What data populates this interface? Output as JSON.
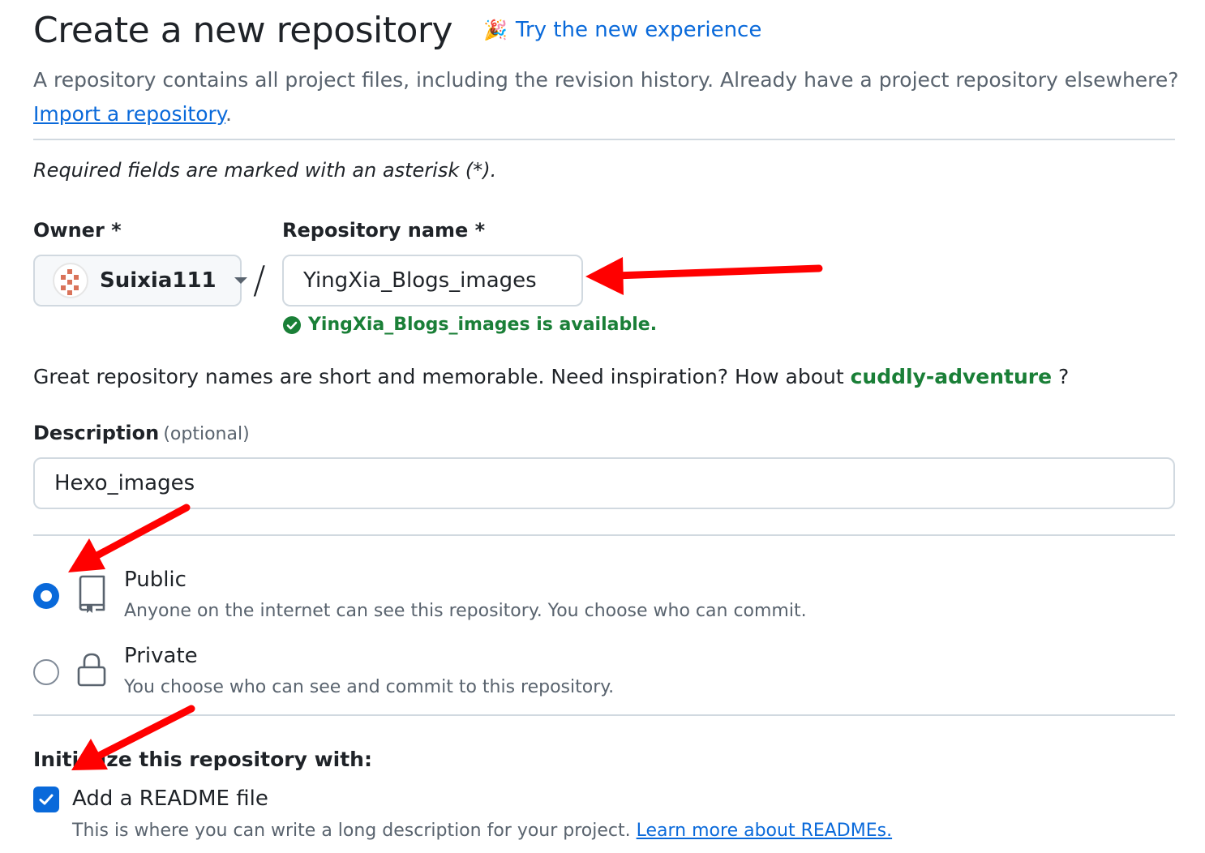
{
  "header": {
    "title": "Create a new repository",
    "try_new_label": "Try the new experience",
    "try_new_icon": "tada-icon"
  },
  "lead": {
    "text": "A repository contains all project files, including the revision history. Already have a project repository elsewhere?",
    "import_link": "Import a repository",
    "import_suffix": "."
  },
  "required_note": "Required fields are marked with an asterisk (*).",
  "owner": {
    "label": "Owner *",
    "value": "Suixia111"
  },
  "separator": "/",
  "repo_name": {
    "label": "Repository name *",
    "value": "YingXia_Blogs_images",
    "availability": "YingXia_Blogs_images is available."
  },
  "suggestion": {
    "text": "Great repository names are short and memorable. Need inspiration? How about",
    "name": "cuddly-adventure",
    "suffix": "?"
  },
  "description": {
    "label": "Description",
    "optional": "(optional)",
    "value": "Hexo_images"
  },
  "visibility": {
    "options": [
      {
        "title": "Public",
        "desc": "Anyone on the internet can see this repository. You choose who can commit.",
        "selected": true,
        "icon": "repo-icon"
      },
      {
        "title": "Private",
        "desc": "You choose who can see and commit to this repository.",
        "selected": false,
        "icon": "lock-icon"
      }
    ]
  },
  "initialize": {
    "title": "Initialize this repository with:",
    "readme_label": "Add a README file",
    "readme_checked": true,
    "readme_desc": "This is where you can write a long description for your project.",
    "readme_link": "Learn more about READMEs."
  },
  "colors": {
    "accent": "#0969da",
    "success": "#1a7f37",
    "annotation_arrow": "#ff0000"
  }
}
